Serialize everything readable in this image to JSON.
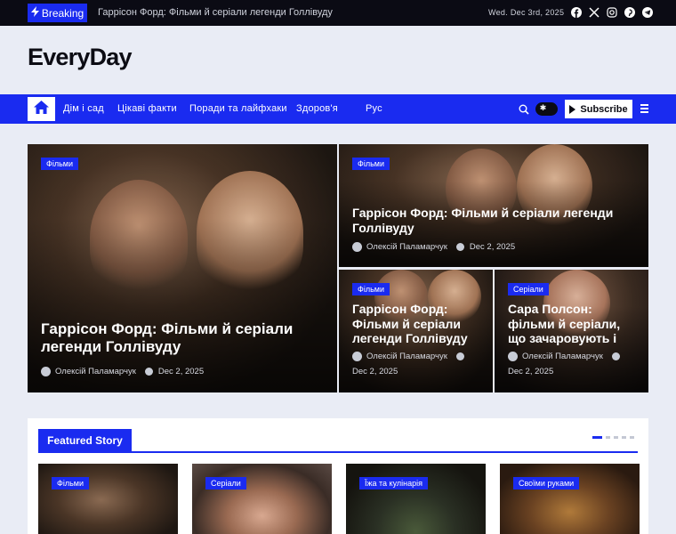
{
  "topbar": {
    "breaking_label": "Breaking",
    "ticker": "Гаррісон Форд: Фільми й серіали легенди Голлівуду",
    "date": "Wed. Dec 3rd, 2025",
    "social_icons": [
      "facebook-icon",
      "x-twitter-icon",
      "instagram-icon",
      "pinterest-icon",
      "telegram-icon"
    ]
  },
  "site": {
    "logo": "EveryDay"
  },
  "nav": {
    "items": [
      "Дім і сад",
      "Цікаві факти",
      "Поради та лайфхаки",
      "Здоров'я",
      "Рус"
    ],
    "subscribe_label": "Subscribe"
  },
  "hero": {
    "main": {
      "category": "Фільми",
      "title": "Гаррісон Форд: Фільми й серіали легенди Голлівуду",
      "author": "Олексій Паламарчук",
      "date": "Dec 2, 2025"
    },
    "top_right": {
      "category": "Фільми",
      "title": "Гаррісон Форд: Фільми й серіали легенди Голлівуду",
      "author": "Олексій Паламарчук",
      "date": "Dec 2, 2025"
    },
    "bottom_left": {
      "category": "Фільми",
      "title": "Гаррісон Форд: Фільми й серіали легенди Голлівуду",
      "author": "Олексій Паламарчук",
      "date": "Dec 2, 2025"
    },
    "bottom_right": {
      "category": "Серіали",
      "title": "Сара Полсон: фільми й серіали, що зачаровують і",
      "author": "Олексій Паламарчук",
      "date": "Dec 2, 2025"
    }
  },
  "featured": {
    "label": "Featured Story",
    "cards": [
      {
        "category": "Фільми"
      },
      {
        "category": "Серіали"
      },
      {
        "category": "Їжа та кулінарія"
      },
      {
        "category": "Своїми руками"
      }
    ]
  },
  "colors": {
    "accent": "#1a2bf0",
    "topbar": "#0b0b14",
    "page_bg": "#e9ecf5"
  }
}
